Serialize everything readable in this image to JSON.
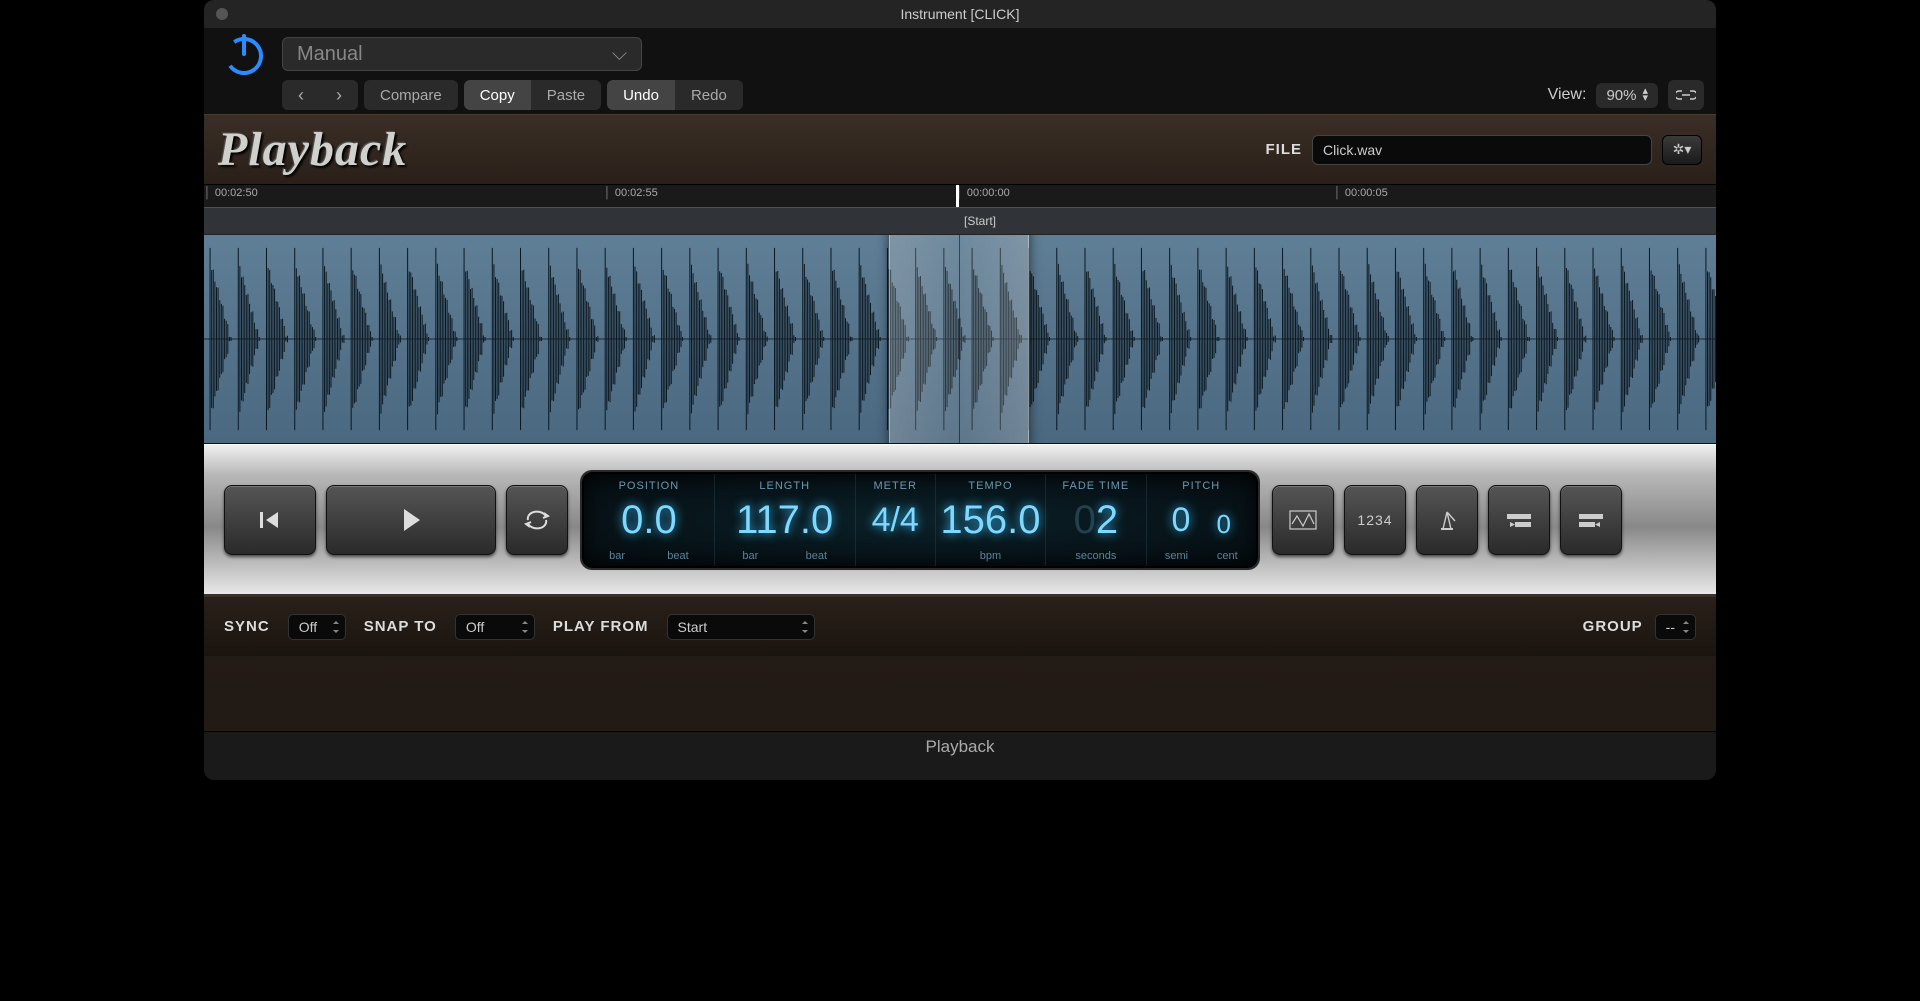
{
  "window": {
    "title": "Instrument [CLICK]"
  },
  "toolbar": {
    "preset": "Manual",
    "compare": "Compare",
    "copy": "Copy",
    "paste": "Paste",
    "undo": "Undo",
    "redo": "Redo",
    "view_label": "View:",
    "view_value": "90%"
  },
  "plugin": {
    "logo": "Playback",
    "file_label": "FILE",
    "file_name": "Click.wav"
  },
  "timeline": {
    "ticks": [
      "00:02:50",
      "00:02:55",
      "00:00:00",
      "00:00:05"
    ],
    "start_marker": "[Start]"
  },
  "lcd": {
    "position": {
      "title": "POSITION",
      "value": "0.0",
      "sub1": "bar",
      "sub2": "beat"
    },
    "length": {
      "title": "LENGTH",
      "value": "117.0",
      "sub1": "bar",
      "sub2": "beat"
    },
    "meter": {
      "title": "METER",
      "value": "4/4"
    },
    "tempo": {
      "title": "TEMPO",
      "value": "156.0",
      "sub": "bpm"
    },
    "fade": {
      "title": "FADE TIME",
      "prefix": "0",
      "value": "2",
      "sub": "seconds"
    },
    "pitch": {
      "title": "PITCH",
      "semi": "0",
      "cent": "0",
      "sub1": "semi",
      "sub2": "cent"
    }
  },
  "right_buttons": {
    "count": "1234"
  },
  "bottom": {
    "sync_label": "SYNC",
    "sync_value": "Off",
    "snapto_label": "SNAP TO",
    "snapto_value": "Off",
    "playfrom_label": "PLAY FROM",
    "playfrom_value": "Start",
    "group_label": "GROUP",
    "group_value": "--"
  },
  "footer": "Playback"
}
